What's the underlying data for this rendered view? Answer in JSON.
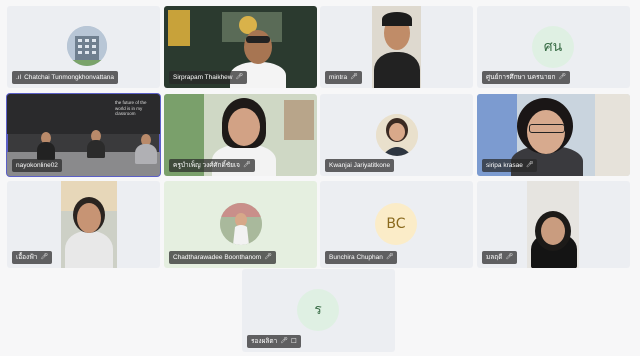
{
  "participants": [
    {
      "name": "Chatchai Tunmongkhonvattana",
      "avatar": "building-photo"
    },
    {
      "name": "Sirprapam Thaikhew",
      "avatar": "video"
    },
    {
      "name": "mintra",
      "avatar": "video"
    },
    {
      "name": "ศูนย์การศึกษา นครนายก",
      "avatar_initials": "ศน"
    },
    {
      "name": "nayokonline02",
      "avatar": "video"
    },
    {
      "name": "ครูบำเพ็ญ วงศ์ศักดิ์ชัยเจ",
      "avatar": "video"
    },
    {
      "name": "Kwanjai Jariyatitkone",
      "avatar": "photo"
    },
    {
      "name": "siripa krasae",
      "avatar": "video"
    },
    {
      "name": "เอื้องฟ้า",
      "avatar": "video"
    },
    {
      "name": "Chadtharawadee Boonthanom",
      "avatar": "photo"
    },
    {
      "name": "Bunchira Chuphan",
      "avatar_initials": "BC"
    },
    {
      "name": "มลฤดี",
      "avatar": "video"
    },
    {
      "name": "รองผลิตา",
      "avatar_initials": "ร"
    }
  ],
  "icons": {
    "muted": "mic-off-icon",
    "signal": "signal-icon",
    "pin": "pin-icon"
  },
  "classroom_sign": "the future of the world is in my classroom",
  "colors": {
    "accent": "#5b5fc7",
    "avatar_bg": "#dff0e3",
    "avatar_text": "#3b6e48",
    "bc_bg": "#fbecc8",
    "bc_text": "#8a6a1e"
  }
}
